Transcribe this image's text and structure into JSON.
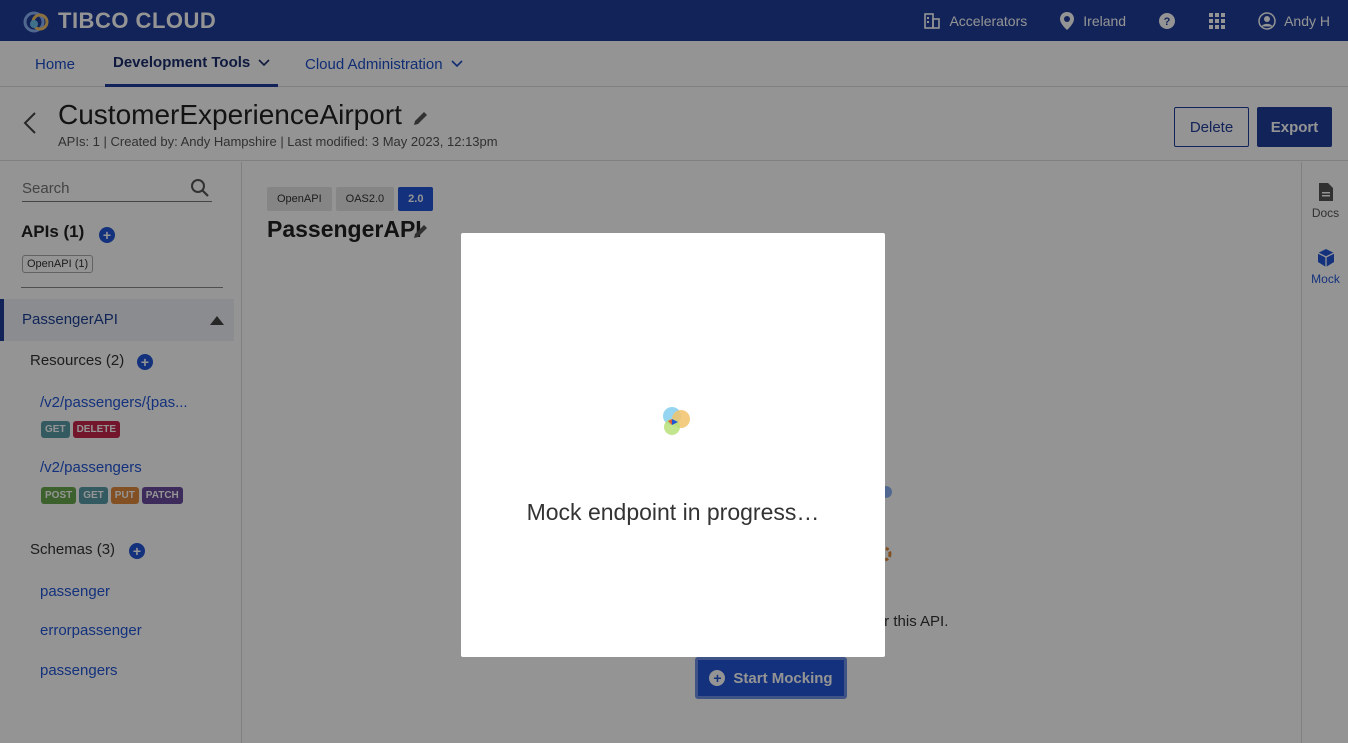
{
  "topbar": {
    "brand": "TIBCO CLOUD",
    "accelerators": "Accelerators",
    "region": "Ireland",
    "user": "Andy H",
    "bg_color": "#1f3d99"
  },
  "nav": {
    "home": "Home",
    "dev_tools": "Development Tools",
    "cloud_admin": "Cloud Administration"
  },
  "header": {
    "title": "CustomerExperienceAirport",
    "meta": "APIs: 1  |  Created by: Andy Hampshire  |  Last modified: 3 May 2023, 12:13pm",
    "delete_label": "Delete",
    "export_label": "Export"
  },
  "sidebar": {
    "search_placeholder": "Search",
    "apis_title": "APIs (1)",
    "openapi_chip": "OpenAPI (1)",
    "api_name": "PassengerAPI",
    "resources_title": "Resources (2)",
    "resources": [
      {
        "path": "/v2/passengers/{pas...",
        "methods": [
          "GET",
          "DELETE"
        ]
      },
      {
        "path": "/v2/passengers",
        "methods": [
          "POST",
          "GET",
          "PUT",
          "PATCH"
        ]
      }
    ],
    "schemas_title": "Schemas (3)",
    "schemas": [
      "passenger",
      "errorpassenger",
      "passengers"
    ]
  },
  "content": {
    "chips": [
      "OpenAPI",
      "OAS2.0",
      "2.0"
    ],
    "api_title": "PassengerAPI",
    "bg_text": "nt for this API.",
    "start_mocking": "Start Mocking"
  },
  "rail": {
    "docs": "Docs",
    "mock": "Mock"
  },
  "modal": {
    "message": "Mock endpoint in progress…"
  },
  "colors": {
    "get": "#5b9ba8",
    "delete": "#c8264a",
    "post": "#6aa84f",
    "put": "#e08a3c",
    "patch": "#6a4a9e"
  }
}
